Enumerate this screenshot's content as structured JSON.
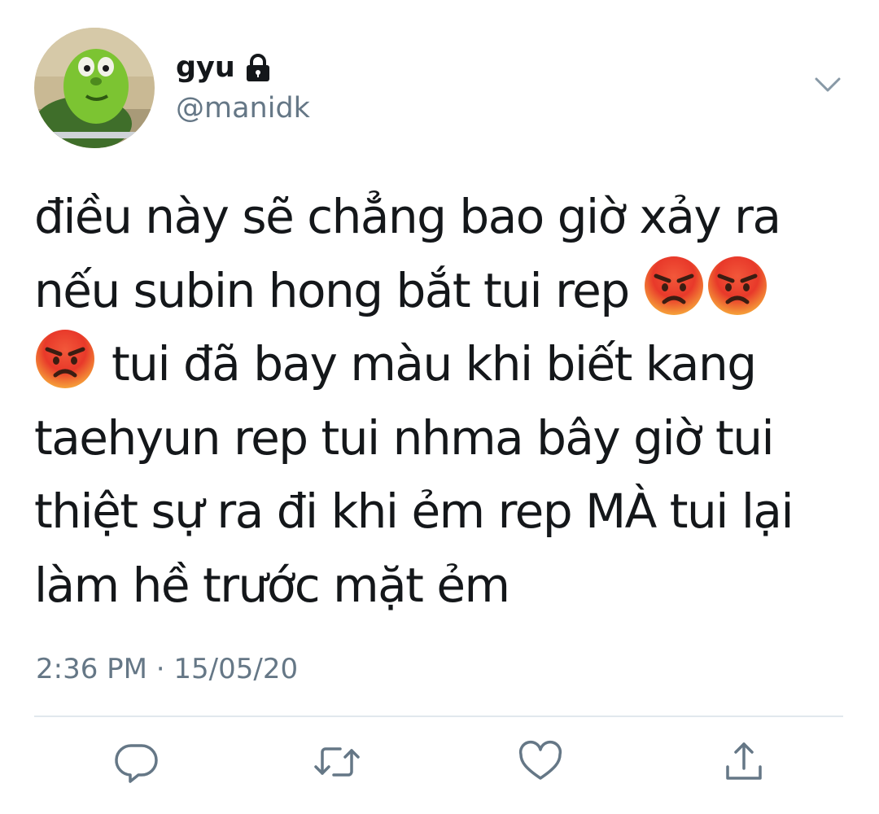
{
  "user": {
    "display_name": "gyu",
    "handle": "@manidk",
    "protected_icon": "lock-icon",
    "avatar_icon": "avatar-image"
  },
  "tweet": {
    "lines": [
      "điều này sẽ chẳng bao giờ xảy ra",
      "nếu subin hong bắt tui rep",
      "tui đã bay màu khi biết kang",
      "taehyun rep tui nhma bây giờ tui",
      "thiệt sự ra đi khi ẻm rep MÀ tui lại",
      "làm hề trước mặt ẻm"
    ],
    "emoji": "pouting-face-emoji",
    "timestamp": "2:36 PM · 15/05/20"
  },
  "actions": [
    "reply-icon",
    "retweet-icon",
    "like-icon",
    "share-icon"
  ],
  "colors": {
    "text": "#14171a",
    "secondary": "#657786",
    "divider": "#e1e8ed",
    "icon": "#657786"
  }
}
